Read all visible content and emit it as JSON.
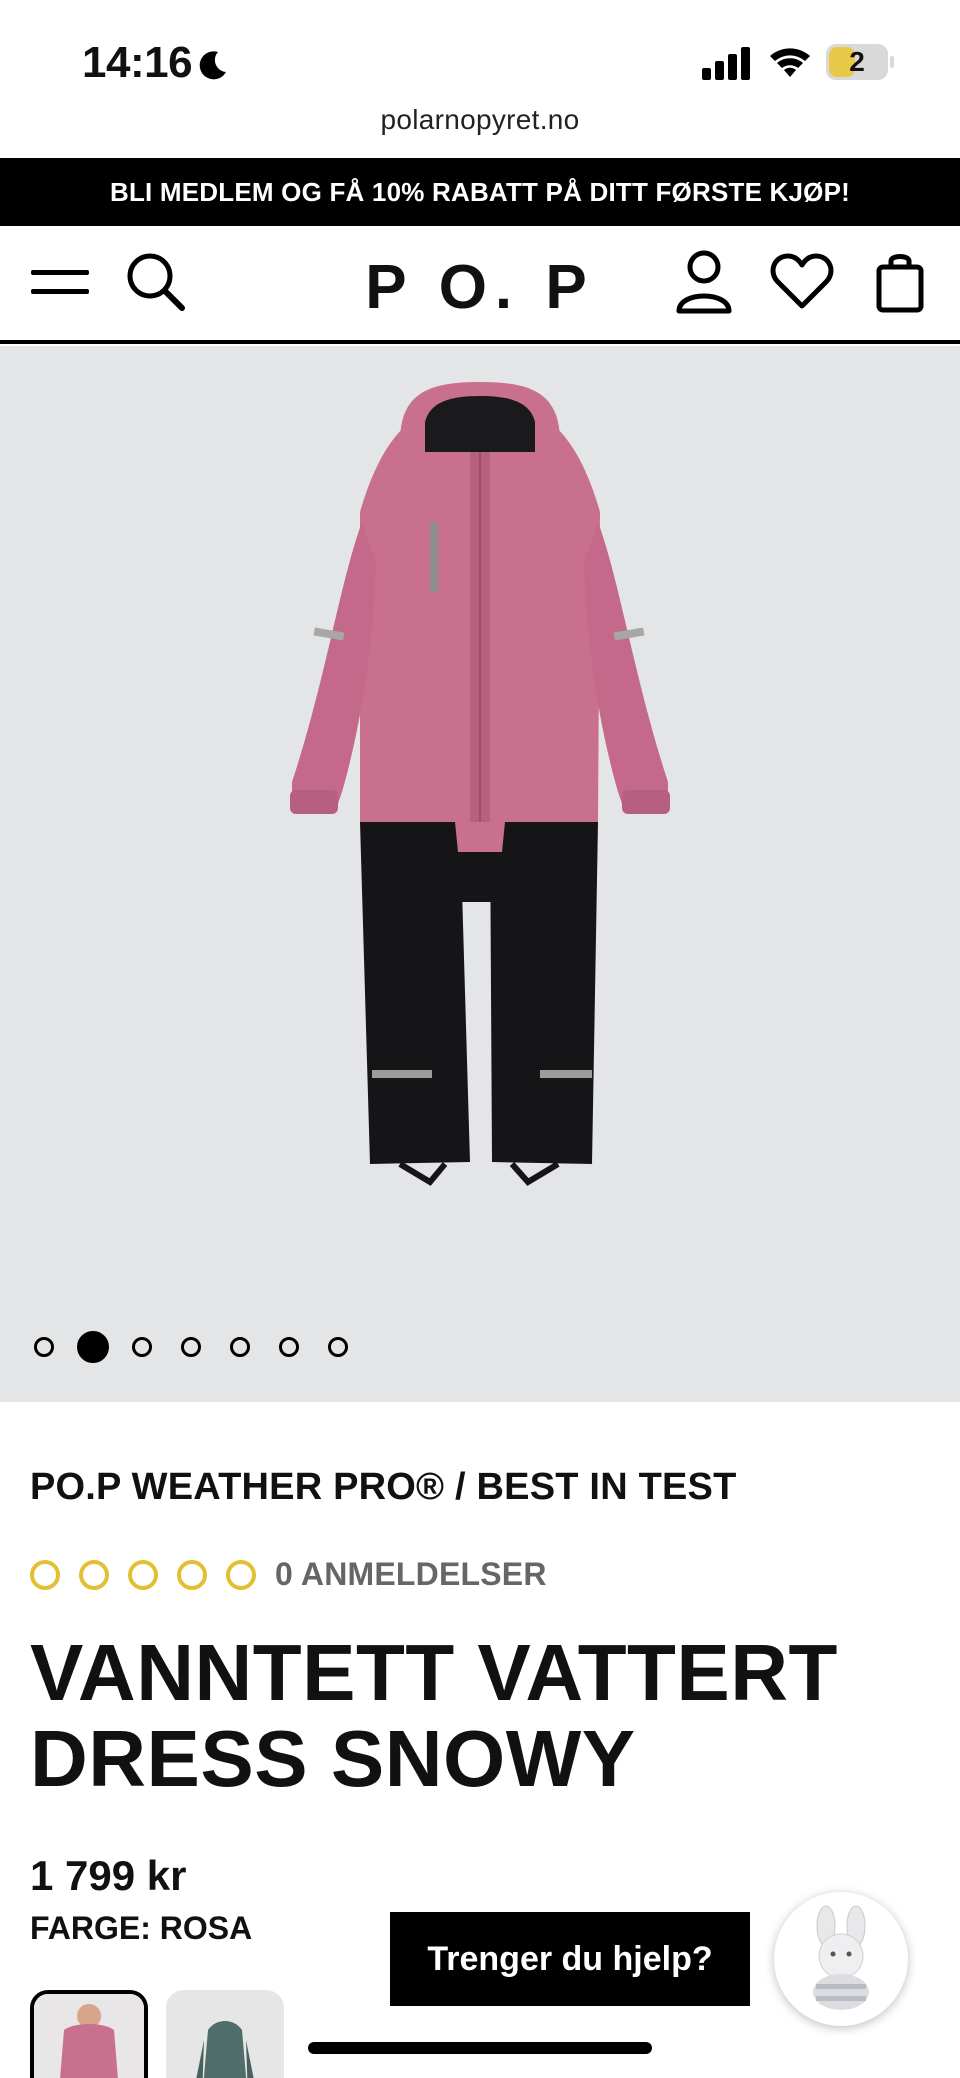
{
  "status": {
    "time": "14:16",
    "battery": "2"
  },
  "browser": {
    "url": "polarnopyret.no"
  },
  "promo": {
    "text": "BLI MEDLEM OG FÅ 10% RABATT PÅ DITT FØRSTE KJØP!"
  },
  "header": {
    "logo": "P O. P",
    "icons": [
      "menu-icon",
      "search-icon",
      "account-icon",
      "heart-icon",
      "bag-icon"
    ]
  },
  "gallery": {
    "image_count": 7,
    "active_index": 1
  },
  "product": {
    "category": "PO.P WEATHER PRO® / BEST IN TEST",
    "rating": {
      "stars": 0,
      "max": 5,
      "reviews_label": "0 ANMELDELSER"
    },
    "title_line1": "VANNTETT VATTERT",
    "title_line2": "DRESS SNOWY",
    "price": "1 799 kr",
    "color_label": "FARGE: ROSA"
  },
  "help": {
    "label": "Trenger du hjelp?"
  },
  "colors": {
    "accent_star": "#e3c032",
    "suit_pink": "#c9708f",
    "suit_black": "#151517"
  }
}
